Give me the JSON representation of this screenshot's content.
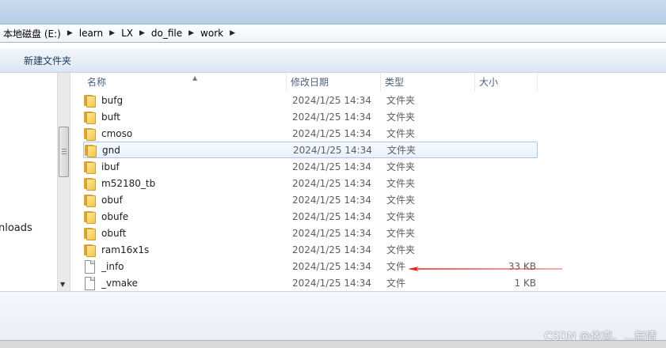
{
  "breadcrumbs": [
    "本地磁盘 (E:)",
    "learn",
    "LX",
    "do_file",
    "work"
  ],
  "toolbar": {
    "new_folder": "新建文件夹"
  },
  "nav": {
    "visible_item": "nloads"
  },
  "columns": {
    "name": "名称",
    "date": "修改日期",
    "type": "类型",
    "size": "大小"
  },
  "files": [
    {
      "name": "bufg",
      "date": "2024/1/25 14:34",
      "type": "文件夹",
      "size": "",
      "icon": "folder-icon"
    },
    {
      "name": "buft",
      "date": "2024/1/25 14:34",
      "type": "文件夹",
      "size": "",
      "icon": "folder-icon"
    },
    {
      "name": "cmoso",
      "date": "2024/1/25 14:34",
      "type": "文件夹",
      "size": "",
      "icon": "folder-icon"
    },
    {
      "name": "gnd",
      "date": "2024/1/25 14:34",
      "type": "文件夹",
      "size": "",
      "icon": "folder-icon",
      "selected": true
    },
    {
      "name": "ibuf",
      "date": "2024/1/25 14:34",
      "type": "文件夹",
      "size": "",
      "icon": "folder-icon"
    },
    {
      "name": "m52180_tb",
      "date": "2024/1/25 14:34",
      "type": "文件夹",
      "size": "",
      "icon": "folder-icon"
    },
    {
      "name": "obuf",
      "date": "2024/1/25 14:34",
      "type": "文件夹",
      "size": "",
      "icon": "folder-icon"
    },
    {
      "name": "obufe",
      "date": "2024/1/25 14:34",
      "type": "文件夹",
      "size": "",
      "icon": "folder-icon"
    },
    {
      "name": "obuft",
      "date": "2024/1/25 14:34",
      "type": "文件夹",
      "size": "",
      "icon": "folder-icon"
    },
    {
      "name": "ram16x1s",
      "date": "2024/1/25 14:34",
      "type": "文件夹",
      "size": "",
      "icon": "folder-icon"
    },
    {
      "name": "_info",
      "date": "2024/1/25 14:34",
      "type": "文件",
      "size": "33 KB",
      "icon": "file-icon"
    },
    {
      "name": "_vmake",
      "date": "2024/1/25 14:34",
      "type": "文件",
      "size": "1 KB",
      "icon": "file-icon"
    }
  ],
  "watermark": "CSDN @依恋、,,,無情",
  "colors": {
    "arrow": "#e8241c",
    "selection_border": "#a9c7ea",
    "folder": "#f3c746"
  }
}
